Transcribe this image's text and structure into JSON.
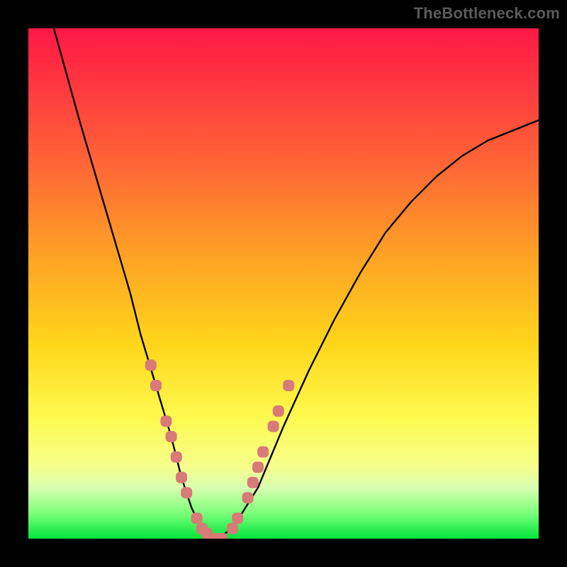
{
  "watermark": "TheBottleneck.com",
  "chart_data": {
    "type": "line",
    "title": "",
    "xlabel": "",
    "ylabel": "",
    "xlim": [
      0,
      100
    ],
    "ylim": [
      0,
      100
    ],
    "curve": {
      "name": "bottleneck-curve",
      "x": [
        5,
        10,
        15,
        20,
        22,
        25,
        28,
        30,
        32,
        34,
        37,
        40,
        45,
        50,
        55,
        60,
        65,
        70,
        75,
        80,
        85,
        90,
        95,
        100
      ],
      "y": [
        100,
        82,
        65,
        48,
        40,
        30,
        20,
        12,
        6,
        2,
        0,
        2,
        10,
        22,
        33,
        43,
        52,
        60,
        66,
        71,
        75,
        78,
        80,
        82
      ]
    },
    "highlights": [
      {
        "x": 24,
        "y": 34
      },
      {
        "x": 25,
        "y": 30
      },
      {
        "x": 27,
        "y": 23
      },
      {
        "x": 28,
        "y": 20
      },
      {
        "x": 29,
        "y": 16
      },
      {
        "x": 30,
        "y": 12
      },
      {
        "x": 31,
        "y": 9
      },
      {
        "x": 33,
        "y": 4
      },
      {
        "x": 34,
        "y": 2
      },
      {
        "x": 35,
        "y": 1
      },
      {
        "x": 37,
        "y": 0
      },
      {
        "x": 38,
        "y": 0
      },
      {
        "x": 40,
        "y": 2
      },
      {
        "x": 41,
        "y": 4
      },
      {
        "x": 43,
        "y": 8
      },
      {
        "x": 44,
        "y": 11
      },
      {
        "x": 45,
        "y": 14
      },
      {
        "x": 46,
        "y": 17
      },
      {
        "x": 48,
        "y": 22
      },
      {
        "x": 49,
        "y": 25
      },
      {
        "x": 51,
        "y": 30
      }
    ],
    "gradient_bands": [
      {
        "y": 100,
        "color": "#ff1846"
      },
      {
        "y": 72,
        "color": "#ff6a35"
      },
      {
        "y": 50,
        "color": "#ffc820"
      },
      {
        "y": 25,
        "color": "#fff94e"
      },
      {
        "y": 8,
        "color": "#c7ffa0"
      },
      {
        "y": 0,
        "color": "#00e63a"
      }
    ]
  }
}
